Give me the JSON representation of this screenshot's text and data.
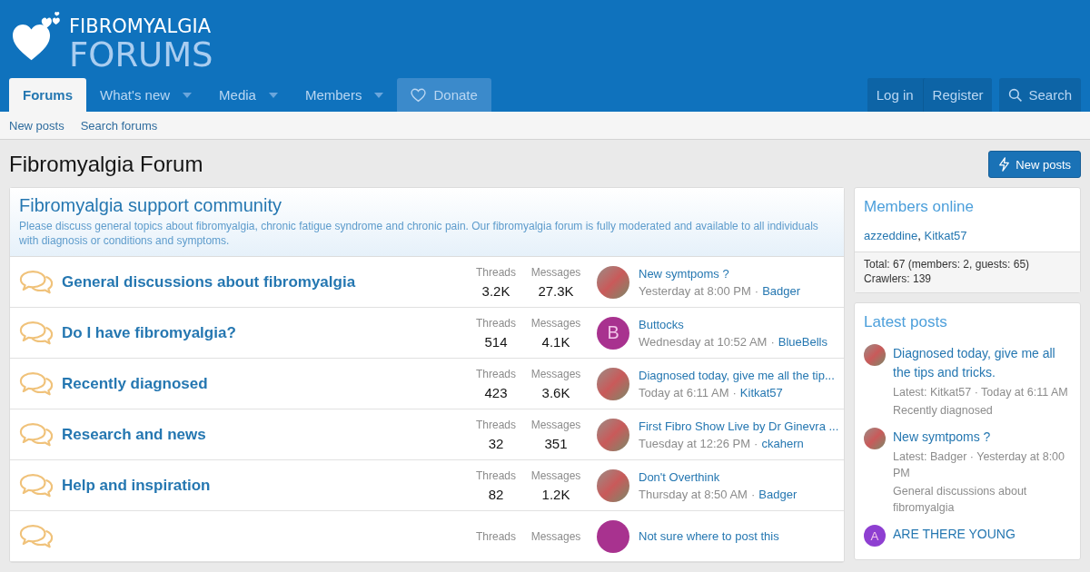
{
  "logo": {
    "line_1": "FIBROMYALGIA",
    "line_2": "FORUMS"
  },
  "nav": {
    "tabs": [
      {
        "label": "Forums",
        "selected": true,
        "menu": false
      },
      {
        "label": "What's new",
        "selected": false,
        "menu": true
      },
      {
        "label": "Media",
        "selected": false,
        "menu": true
      },
      {
        "label": "Members",
        "selected": false,
        "menu": true
      }
    ],
    "donate": "Donate",
    "login": "Log in",
    "register": "Register",
    "search": "Search"
  },
  "subnav": [
    "New posts",
    "Search forums"
  ],
  "page_title": "Fibromyalgia Forum",
  "new_posts_button": "New posts",
  "category": {
    "title": "Fibromyalgia support community",
    "description": "Please discuss general topics about fibromyalgia, chronic fatigue syndrome and chronic pain. Our fibromyalgia forum is fully moderated and available to all individuals with diagnosis or conditions and symptoms."
  },
  "forums": [
    {
      "title": "General discussions about fibromyalgia",
      "threads_label": "Threads",
      "threads": "3.2K",
      "messages_label": "Messages",
      "messages": "27.3K",
      "avatar": {
        "kind": "photo"
      },
      "last_post": "New symtpoms ?",
      "date": "Yesterday at 8:00 PM",
      "separator": "·",
      "user": "Badger"
    },
    {
      "title": "Do I have fibromyalgia?",
      "threads_label": "Threads",
      "threads": "514",
      "messages_label": "Messages",
      "messages": "4.1K",
      "avatar": {
        "kind": "letter",
        "letter": "B",
        "color": "#a8328f"
      },
      "last_post": "Buttocks",
      "date": "Wednesday at 10:52 AM",
      "separator": "·",
      "user": "BlueBells"
    },
    {
      "title": "Recently diagnosed",
      "threads_label": "Threads",
      "threads": "423",
      "messages_label": "Messages",
      "messages": "3.6K",
      "avatar": {
        "kind": "photo"
      },
      "last_post": "Diagnosed today, give me all the tip...",
      "date": "Today at 6:11 AM",
      "separator": "·",
      "user": "Kitkat57"
    },
    {
      "title": "Research and news",
      "threads_label": "Threads",
      "threads": "32",
      "messages_label": "Messages",
      "messages": "351",
      "avatar": {
        "kind": "photo"
      },
      "last_post": "First Fibro Show Live by Dr Ginevra ...",
      "date": "Tuesday at 12:26 PM",
      "separator": "·",
      "user": "ckahern"
    },
    {
      "title": "Help and inspiration",
      "threads_label": "Threads",
      "threads": "82",
      "messages_label": "Messages",
      "messages": "1.2K",
      "avatar": {
        "kind": "photo"
      },
      "last_post": "Don't Overthink",
      "date": "Thursday at 8:50 AM",
      "separator": "·",
      "user": "Badger"
    },
    {
      "threads_label": "Threads",
      "messages_label": "Messages",
      "avatar": {
        "kind": "letter",
        "color": "#a8328f"
      },
      "last_post": "Not sure where to post this"
    }
  ],
  "members_online": {
    "title": "Members online",
    "members": [
      "azzeddine",
      "Kitkat57"
    ],
    "member_separator": ",",
    "total": "Total: 67 (members: 2, guests: 65)",
    "crawlers": "Crawlers: 139"
  },
  "latest_posts": {
    "title": "Latest posts",
    "items": [
      {
        "avatar": {
          "kind": "photo"
        },
        "title": "Diagnosed today, give me all the tips and tricks.",
        "meta": "Latest: Kitkat57 · Today at 6:11 AM",
        "forum": "Recently diagnosed"
      },
      {
        "avatar": {
          "kind": "photo"
        },
        "title": "New symtpoms ?",
        "meta": "Latest: Badger · Yesterday at 8:00 PM",
        "forum": "General discussions about fibromyalgia"
      },
      {
        "avatar": {
          "kind": "letter",
          "letter": "A",
          "color": "#8e3fd1"
        },
        "title": "ARE THERE YOUNG"
      }
    ]
  }
}
